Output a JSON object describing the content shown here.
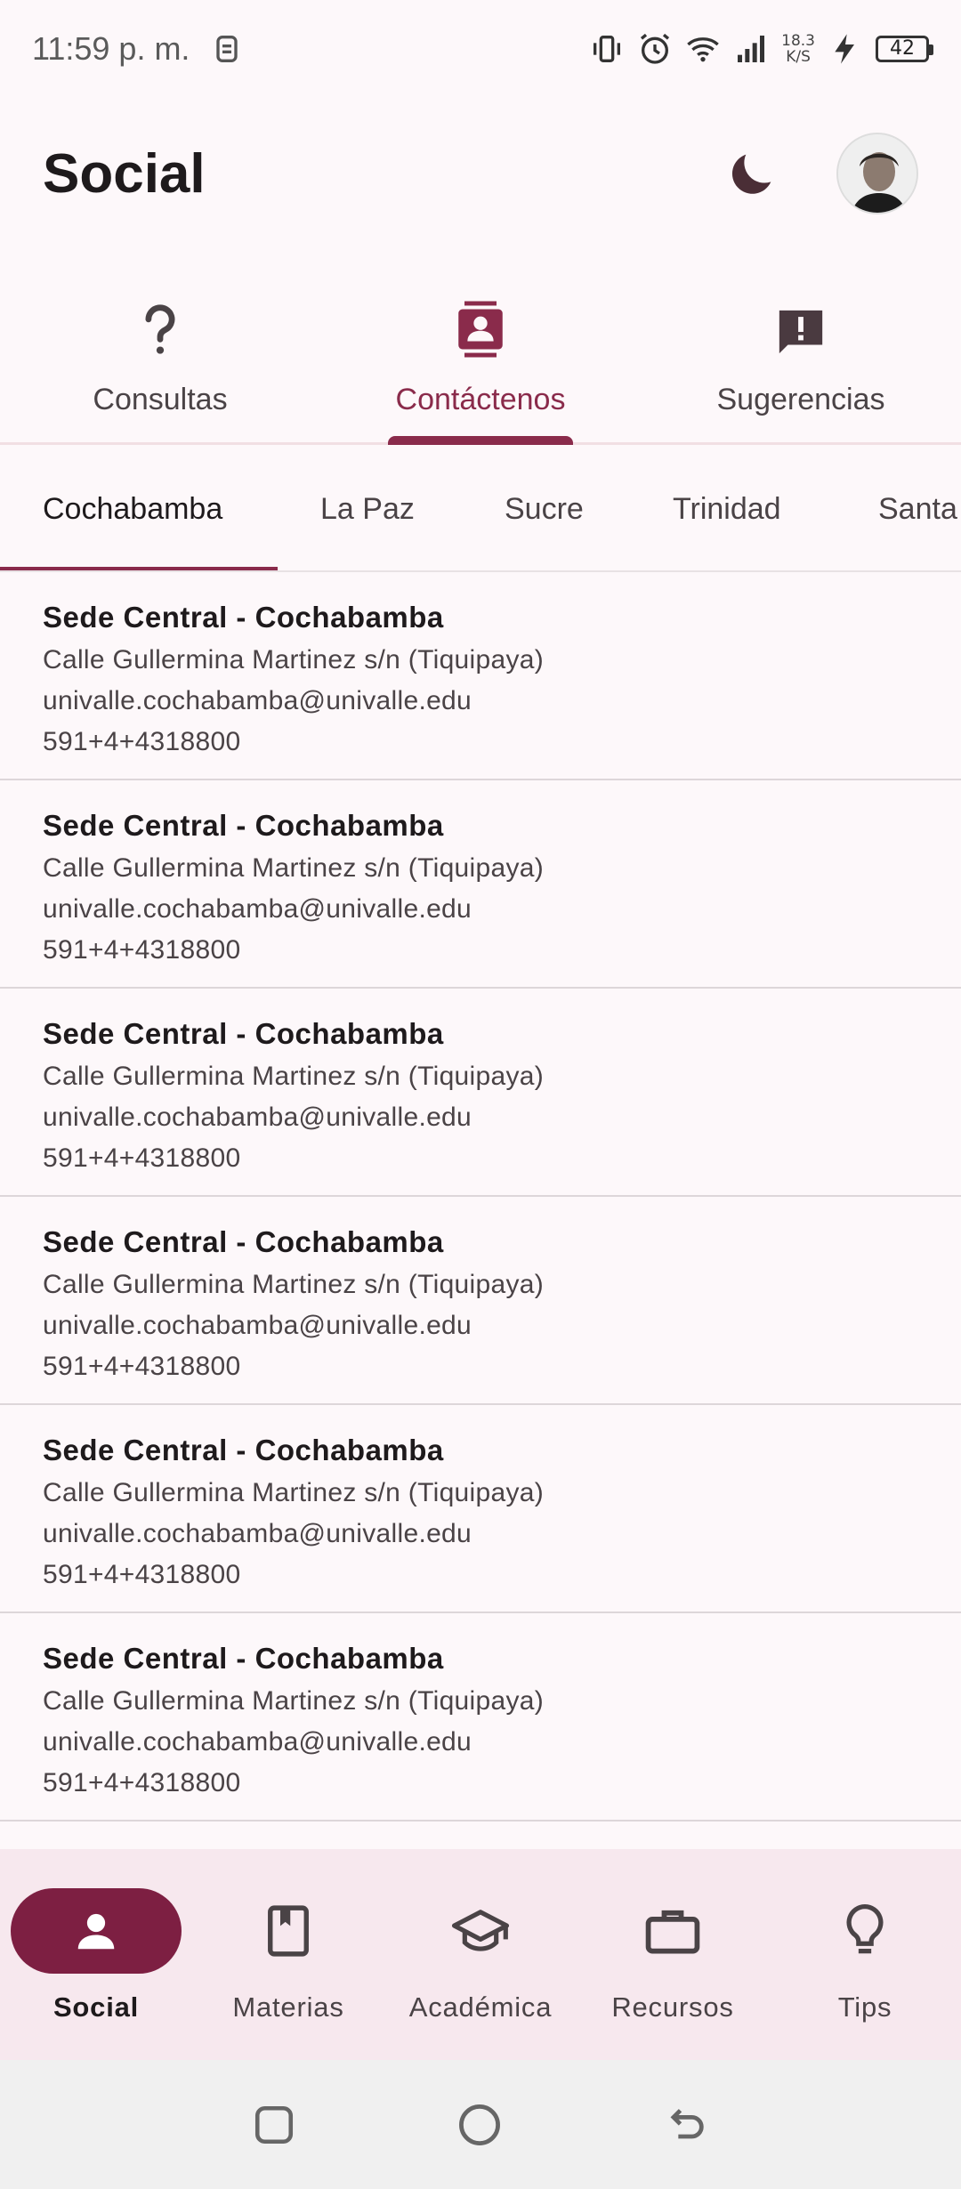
{
  "status_bar": {
    "time": "11:59 p. m.",
    "net_speed_value": "18.3",
    "net_speed_unit": "K/S",
    "battery": "42",
    "icons": [
      "sim-card-icon",
      "vibrate-icon",
      "alarm-icon",
      "wifi-icon",
      "signal-icon",
      "charging-icon"
    ]
  },
  "app_bar": {
    "title": "Social",
    "theme_icon": "moon-icon",
    "avatar_icon": "user-avatar"
  },
  "top_tabs": [
    {
      "label": "Consultas",
      "icon": "question-mark-icon",
      "active": false
    },
    {
      "label": "Contáctenos",
      "icon": "contact-card-icon",
      "active": true
    },
    {
      "label": "Sugerencias",
      "icon": "feedback-icon",
      "active": false
    }
  ],
  "city_tabs": [
    {
      "label": "Cochabamba",
      "active": true
    },
    {
      "label": "La Paz",
      "active": false
    },
    {
      "label": "Sucre",
      "active": false
    },
    {
      "label": "Trinidad",
      "active": false
    },
    {
      "label": "Santa",
      "active": false
    }
  ],
  "contacts": [
    {
      "title": "Sede Central - Cochabamba",
      "address": "Calle Gullermina Martinez s/n (Tiquipaya)",
      "email": "univalle.cochabamba@univalle.edu",
      "phone": "591+4+4318800"
    },
    {
      "title": "Sede Central - Cochabamba",
      "address": "Calle Gullermina Martinez s/n (Tiquipaya)",
      "email": "univalle.cochabamba@univalle.edu",
      "phone": "591+4+4318800"
    },
    {
      "title": "Sede Central - Cochabamba",
      "address": "Calle Gullermina Martinez s/n (Tiquipaya)",
      "email": "univalle.cochabamba@univalle.edu",
      "phone": "591+4+4318800"
    },
    {
      "title": "Sede Central - Cochabamba",
      "address": "Calle Gullermina Martinez s/n (Tiquipaya)",
      "email": "univalle.cochabamba@univalle.edu",
      "phone": "591+4+4318800"
    },
    {
      "title": "Sede Central - Cochabamba",
      "address": "Calle Gullermina Martinez s/n (Tiquipaya)",
      "email": "univalle.cochabamba@univalle.edu",
      "phone": "591+4+4318800"
    },
    {
      "title": "Sede Central - Cochabamba",
      "address": "Calle Gullermina Martinez s/n (Tiquipaya)",
      "email": "univalle.cochabamba@univalle.edu",
      "phone": "591+4+4318800"
    }
  ],
  "bottom_nav": [
    {
      "label": "Social",
      "icon": "person-icon",
      "active": true
    },
    {
      "label": "Materias",
      "icon": "book-icon",
      "active": false
    },
    {
      "label": "Académica",
      "icon": "graduation-cap-icon",
      "active": false
    },
    {
      "label": "Recursos",
      "icon": "briefcase-icon",
      "active": false
    },
    {
      "label": "Tips",
      "icon": "lightbulb-icon",
      "active": false
    }
  ],
  "system_nav": [
    "recents-icon",
    "home-icon",
    "back-icon"
  ],
  "colors": {
    "accent": "#8a2b4b",
    "accent_dark": "#7d1f42",
    "background": "#fdf8fa",
    "nav_background": "#f7e8ee"
  }
}
